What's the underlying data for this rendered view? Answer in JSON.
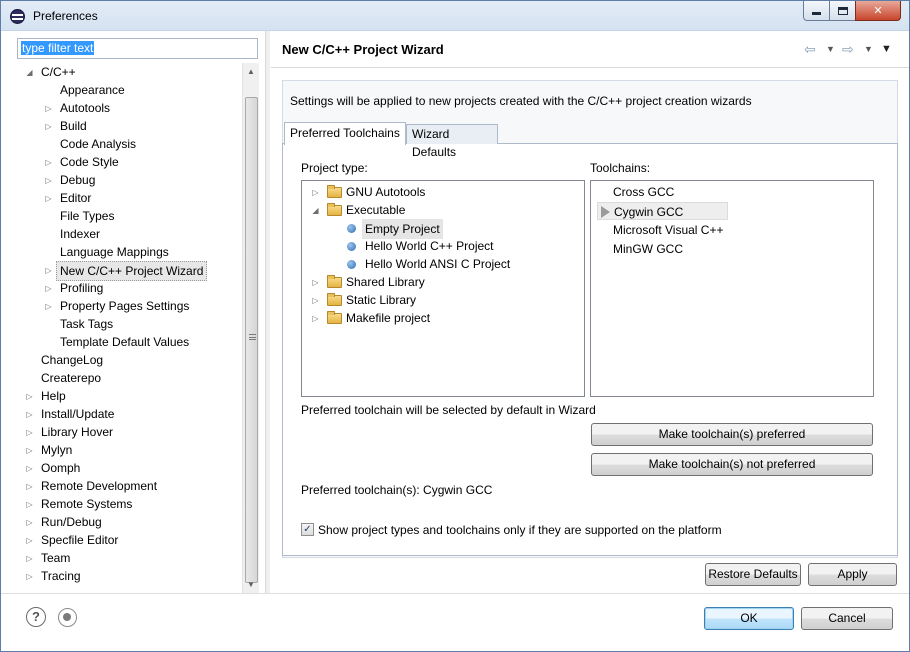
{
  "window": {
    "title": "Preferences"
  },
  "filter": {
    "value": "type filter text"
  },
  "tree": [
    {
      "label": "C/C++",
      "indent": 0,
      "toggle": "open"
    },
    {
      "label": "Appearance",
      "indent": 1,
      "toggle": "none"
    },
    {
      "label": "Autotools",
      "indent": 1,
      "toggle": "closed"
    },
    {
      "label": "Build",
      "indent": 1,
      "toggle": "closed"
    },
    {
      "label": "Code Analysis",
      "indent": 1,
      "toggle": "none"
    },
    {
      "label": "Code Style",
      "indent": 1,
      "toggle": "closed"
    },
    {
      "label": "Debug",
      "indent": 1,
      "toggle": "closed"
    },
    {
      "label": "Editor",
      "indent": 1,
      "toggle": "closed"
    },
    {
      "label": "File Types",
      "indent": 1,
      "toggle": "none"
    },
    {
      "label": "Indexer",
      "indent": 1,
      "toggle": "none"
    },
    {
      "label": "Language Mappings",
      "indent": 1,
      "toggle": "none"
    },
    {
      "label": "New C/C++ Project Wizard",
      "indent": 1,
      "toggle": "closed",
      "selected": true
    },
    {
      "label": "Profiling",
      "indent": 1,
      "toggle": "closed"
    },
    {
      "label": "Property Pages Settings",
      "indent": 1,
      "toggle": "closed"
    },
    {
      "label": "Task Tags",
      "indent": 1,
      "toggle": "none"
    },
    {
      "label": "Template Default Values",
      "indent": 1,
      "toggle": "none"
    },
    {
      "label": "ChangeLog",
      "indent": 0,
      "toggle": "none"
    },
    {
      "label": "Createrepo",
      "indent": 0,
      "toggle": "none"
    },
    {
      "label": "Help",
      "indent": 0,
      "toggle": "closed"
    },
    {
      "label": "Install/Update",
      "indent": 0,
      "toggle": "closed"
    },
    {
      "label": "Library Hover",
      "indent": 0,
      "toggle": "closed"
    },
    {
      "label": "Mylyn",
      "indent": 0,
      "toggle": "closed"
    },
    {
      "label": "Oomph",
      "indent": 0,
      "toggle": "closed"
    },
    {
      "label": "Remote Development",
      "indent": 0,
      "toggle": "closed"
    },
    {
      "label": "Remote Systems",
      "indent": 0,
      "toggle": "closed"
    },
    {
      "label": "Run/Debug",
      "indent": 0,
      "toggle": "closed"
    },
    {
      "label": "Specfile Editor",
      "indent": 0,
      "toggle": "closed"
    },
    {
      "label": "Team",
      "indent": 0,
      "toggle": "closed"
    },
    {
      "label": "Tracing",
      "indent": 0,
      "toggle": "closed"
    }
  ],
  "page": {
    "title": "New C/C++ Project Wizard",
    "settings_note": "Settings will be applied to new projects created with the C/C++ project creation wizards",
    "tabs": [
      "Preferred Toolchains",
      "Wizard Defaults"
    ],
    "project_type_label": "Project type:",
    "toolchains_label": "Toolchains:",
    "project_types": [
      {
        "label": "GNU Autotools",
        "kind": "folder",
        "toggle": "closed",
        "indent": 0
      },
      {
        "label": "Executable",
        "kind": "folder",
        "toggle": "open",
        "indent": 0
      },
      {
        "label": "Empty Project",
        "kind": "item",
        "indent": 1,
        "selected": true
      },
      {
        "label": "Hello World C++ Project",
        "kind": "item",
        "indent": 1
      },
      {
        "label": "Hello World ANSI C Project",
        "kind": "item",
        "indent": 1
      },
      {
        "label": "Shared Library",
        "kind": "folder",
        "toggle": "closed",
        "indent": 0
      },
      {
        "label": "Static Library",
        "kind": "folder",
        "toggle": "closed",
        "indent": 0
      },
      {
        "label": "Makefile project",
        "kind": "folder",
        "toggle": "closed",
        "indent": 0
      }
    ],
    "toolchains": [
      {
        "label": "Cross GCC"
      },
      {
        "label": "Cygwin GCC",
        "selected": true
      },
      {
        "label": "Microsoft Visual C++"
      },
      {
        "label": "MinGW GCC"
      }
    ],
    "preferred_note": "Preferred toolchain will be selected by default in Wizard",
    "make_preferred": "Make toolchain(s) preferred",
    "make_not_preferred": "Make toolchain(s) not preferred",
    "preferred_status": "Preferred toolchain(s): Cygwin GCC",
    "supported_only_label": "Show project types and toolchains only if they are supported on the platform",
    "supported_only_checked": true,
    "restore_defaults": "Restore Defaults",
    "apply": "Apply"
  },
  "footer": {
    "ok": "OK",
    "cancel": "Cancel"
  }
}
